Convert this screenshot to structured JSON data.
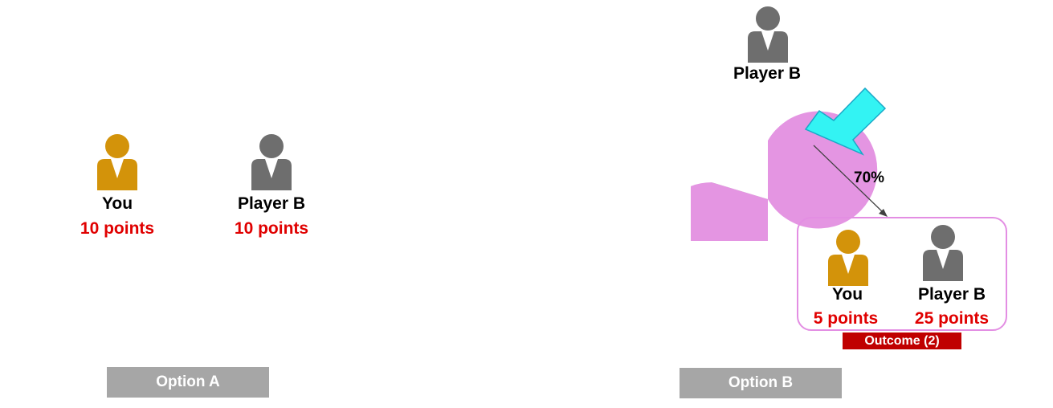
{
  "colors": {
    "you": "#d3930a",
    "player_b": "#6e6e6e",
    "points": "#e00000",
    "option_button": "#a6a6a6",
    "outcome_tag": "#c00000",
    "pie_main": "#e495e2",
    "pie_minor": "#b3f7b5",
    "pointer_arrow": "#33f3f3"
  },
  "option_a": {
    "you": {
      "name": "You",
      "points": "10 points"
    },
    "player_b": {
      "name": "Player B",
      "points": "10 points"
    },
    "button_label": "Option A"
  },
  "option_b": {
    "player_b_top": {
      "name": "Player B"
    },
    "pie": {
      "main_share": 0.7,
      "minor_share": 0.3
    },
    "probability_label": "70%",
    "outcome": {
      "you": {
        "name": "You",
        "points": "5 points"
      },
      "player_b": {
        "name": "Player B",
        "points": "25 points"
      },
      "tag": "Outcome (2)"
    },
    "button_label": "Option B"
  }
}
